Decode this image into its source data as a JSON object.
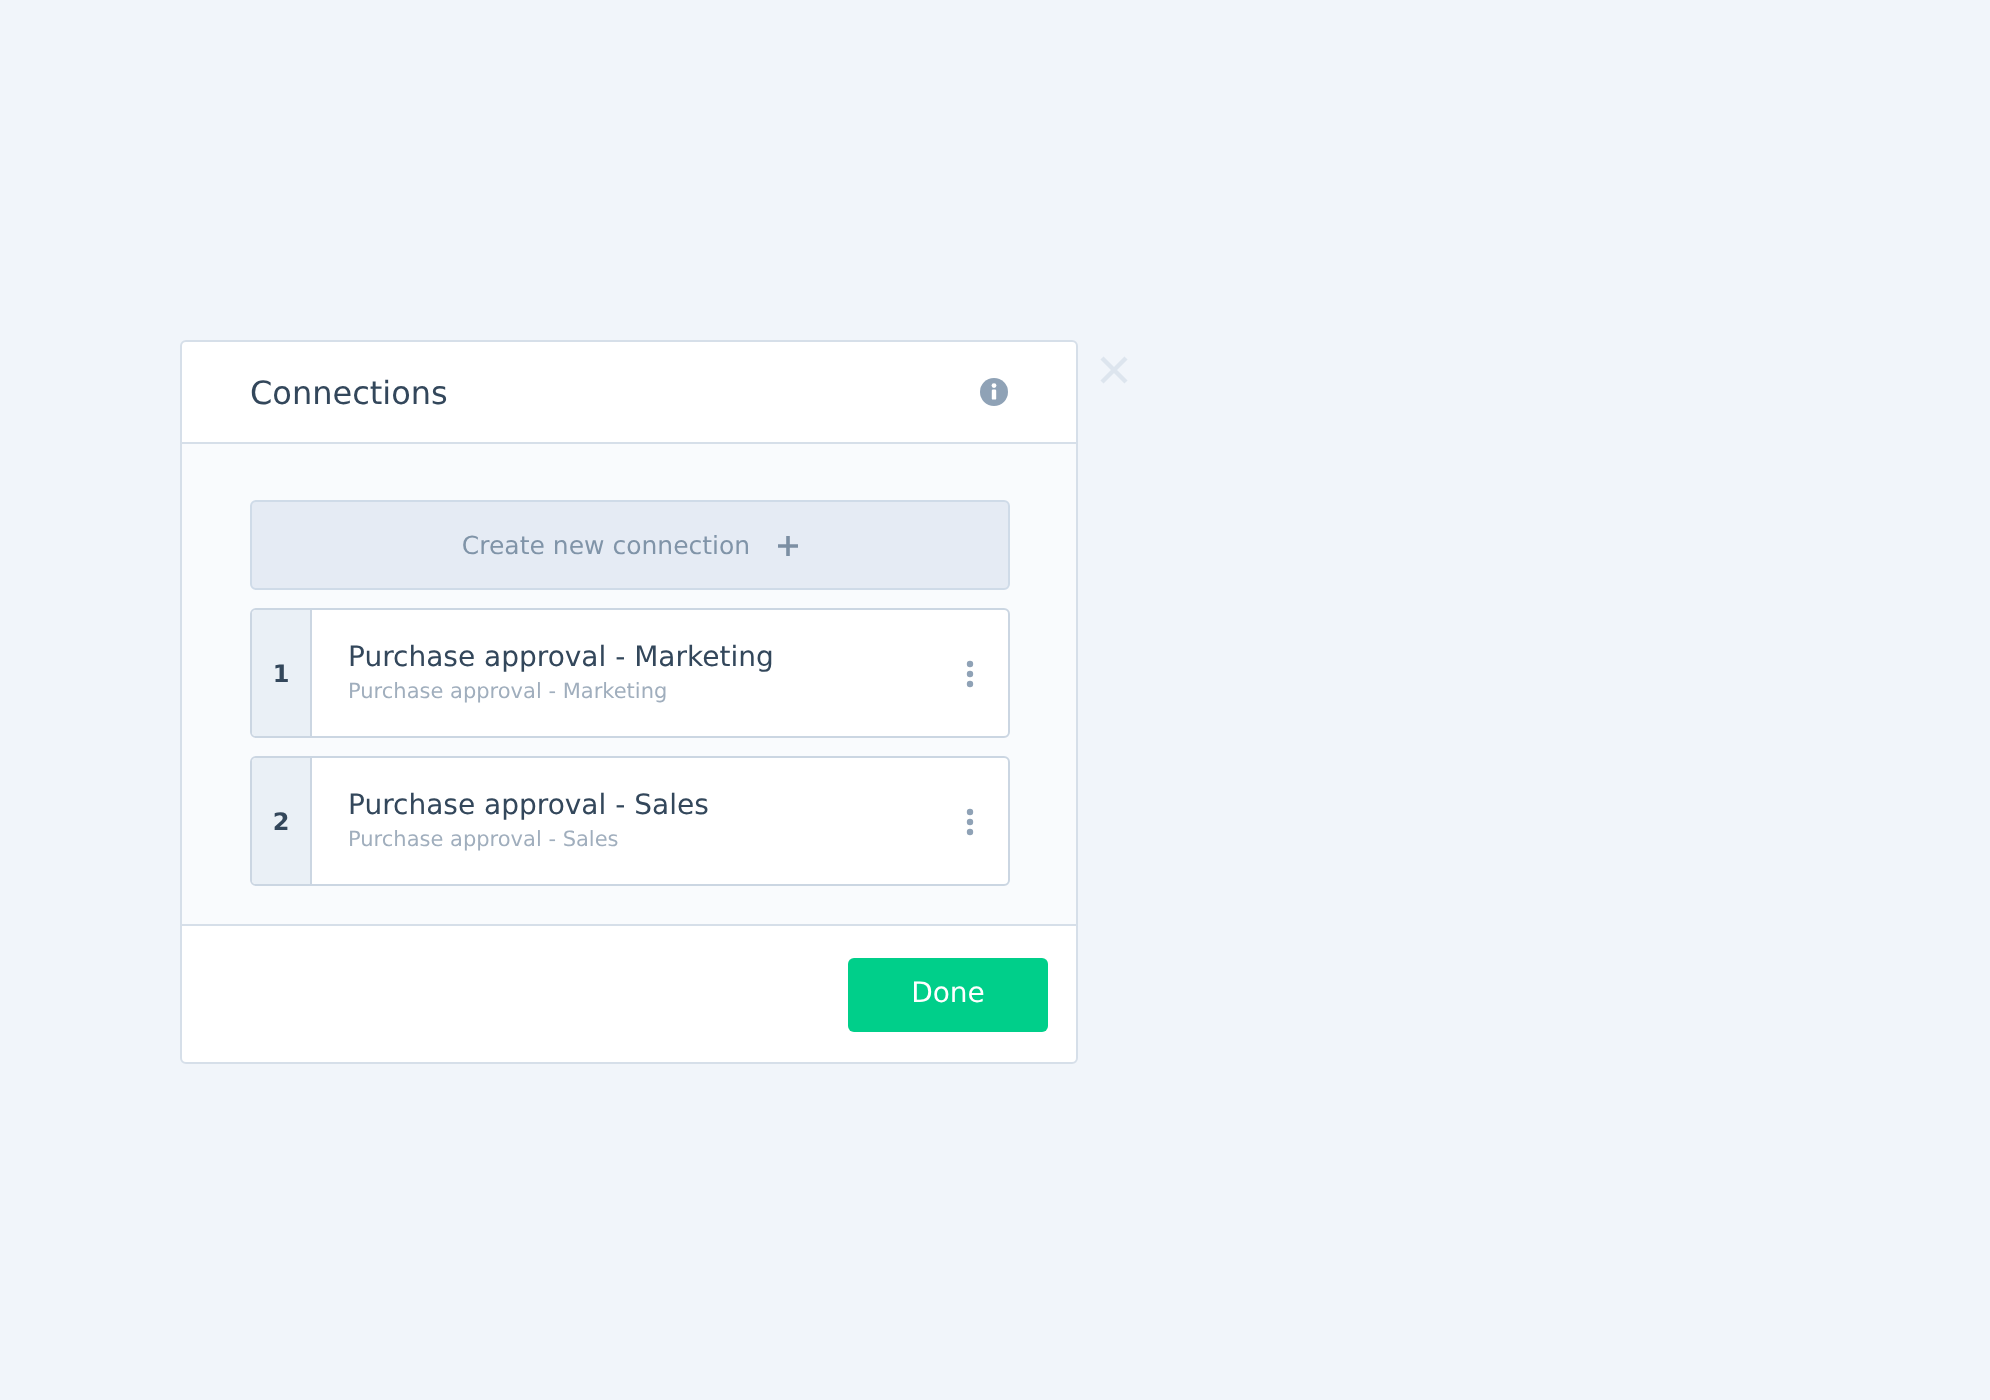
{
  "dialog": {
    "title": "Connections"
  },
  "create_button": {
    "label": "Create new connection"
  },
  "connections": [
    {
      "number": "1",
      "title": "Purchase approval - Marketing",
      "subtitle": "Purchase approval - Marketing"
    },
    {
      "number": "2",
      "title": "Purchase approval - Sales",
      "subtitle": "Purchase approval - Sales"
    }
  ],
  "footer": {
    "button": "Done"
  }
}
